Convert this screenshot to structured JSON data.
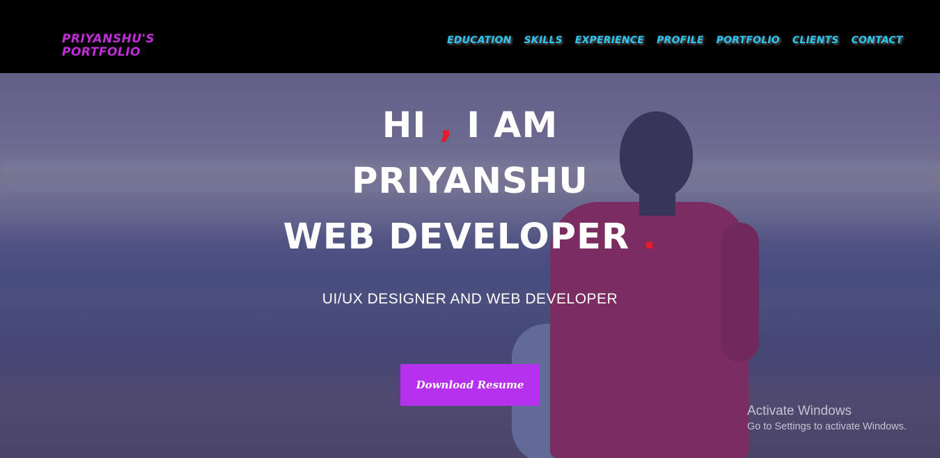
{
  "brand": {
    "line1": "PRIYANSHU'S",
    "line2": "PORTFOLIO"
  },
  "nav": {
    "items": [
      "EDUCATION",
      "SKILLS",
      "EXPERIENCE",
      "PROFILE",
      "PORTFOLIO",
      "CLIENTS",
      "CONTACT"
    ]
  },
  "hero": {
    "line1_a": "HI ",
    "line1_comma": ",",
    "line1_b": " I AM",
    "line2": "PRIYANSHU",
    "line3": "WEB DEVELOPER ",
    "line3_dot": ".",
    "subtitle": "UI/UX DESIGNER AND WEB DEVELOPER",
    "button_label": "Download Resume"
  },
  "watermark": {
    "title": "Activate Windows",
    "subtitle": "Go to Settings to activate Windows."
  },
  "colors": {
    "brand": "#c12ed8",
    "nav": "#2fc4f2",
    "accent": "#e81b2c",
    "button": "#b631ee",
    "header_bg": "#000000"
  }
}
